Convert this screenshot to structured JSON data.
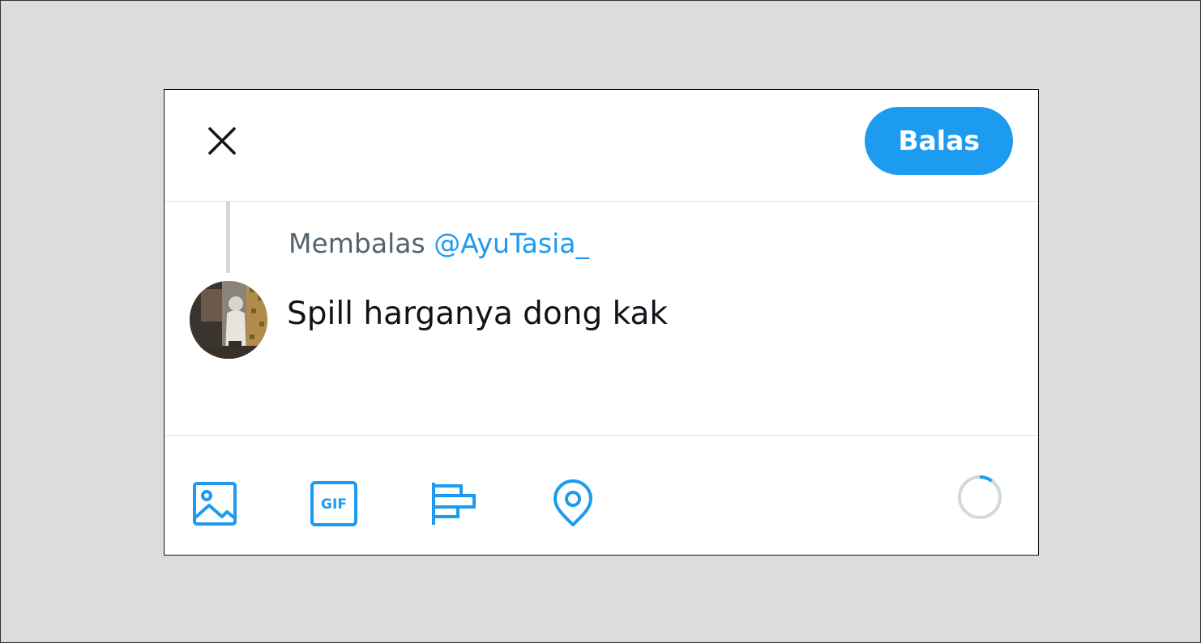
{
  "header": {
    "close_icon": "close-icon",
    "reply_label": "Balas"
  },
  "reply_context": {
    "prefix": "Membalas",
    "handle": "@AyuTasia_"
  },
  "compose": {
    "text": "Spill harganya dong kak"
  },
  "toolbar": {
    "icons": [
      "image-icon",
      "gif-icon",
      "poll-icon",
      "location-icon"
    ],
    "character_counter_progress": 0.1
  },
  "colors": {
    "accent": "#1d9bf0",
    "muted": "#536471",
    "text": "#0f1419",
    "divider": "#dde1e5",
    "counter_track": "#cfd9de"
  }
}
